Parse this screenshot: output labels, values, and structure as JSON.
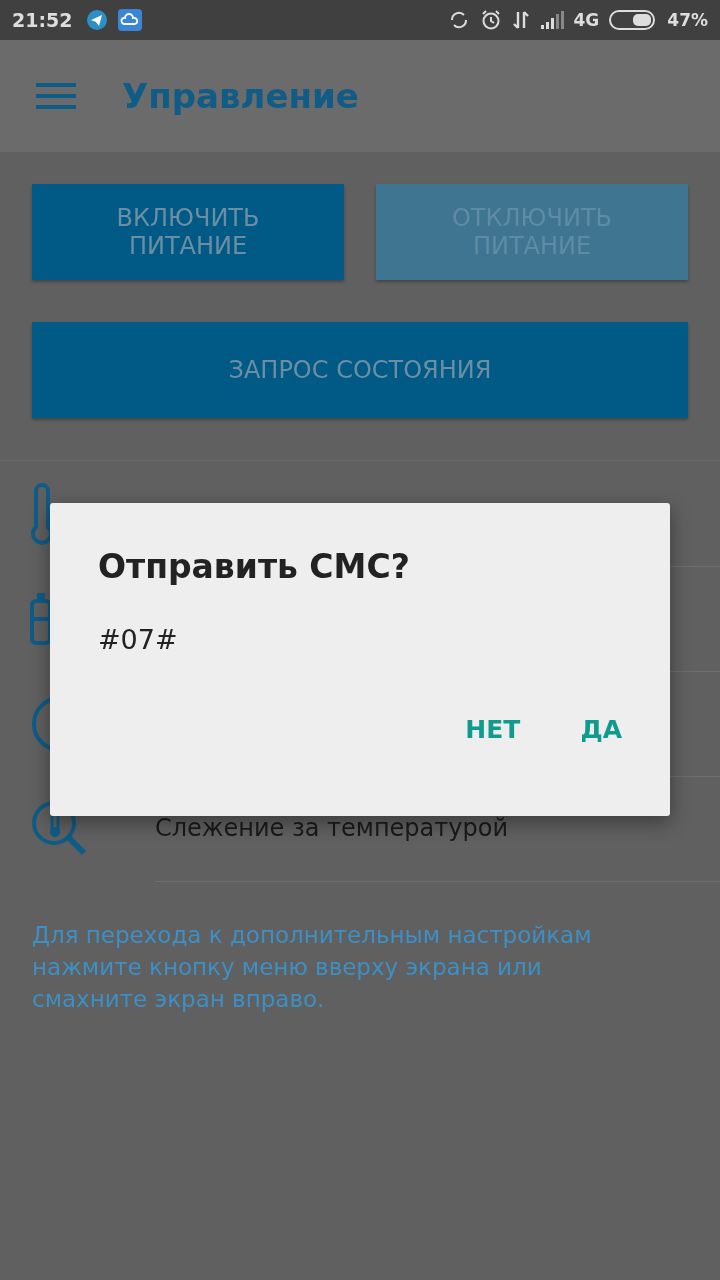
{
  "status_bar": {
    "time": "21:52",
    "network": "4G",
    "battery": "47%"
  },
  "app_bar": {
    "title": "Управление"
  },
  "power_buttons": [
    {
      "label": "ВКЛЮЧИТЬ ПИТАНИЕ",
      "disabled": false
    },
    {
      "label": "ОТКЛЮЧИТЬ ПИТАНИЕ",
      "disabled": true
    }
  ],
  "status_button": {
    "label": "ЗАПРОС СОСТОЯНИЯ",
    "disabled": false
  },
  "list_items": [
    {
      "kind": "thermometer"
    },
    {
      "kind": "battery"
    },
    {
      "kind": "clock"
    },
    {
      "kind": "temperature-search",
      "label": "Слежение за температурой"
    }
  ],
  "hint": "Для перехода к дополнительным настройкам нажмите кнопку меню вверху экрана или смахните экран вправо.",
  "dialog": {
    "title": "Отправить СМС?",
    "message": "#07#",
    "actions": [
      "НЕТ",
      "ДА"
    ]
  }
}
